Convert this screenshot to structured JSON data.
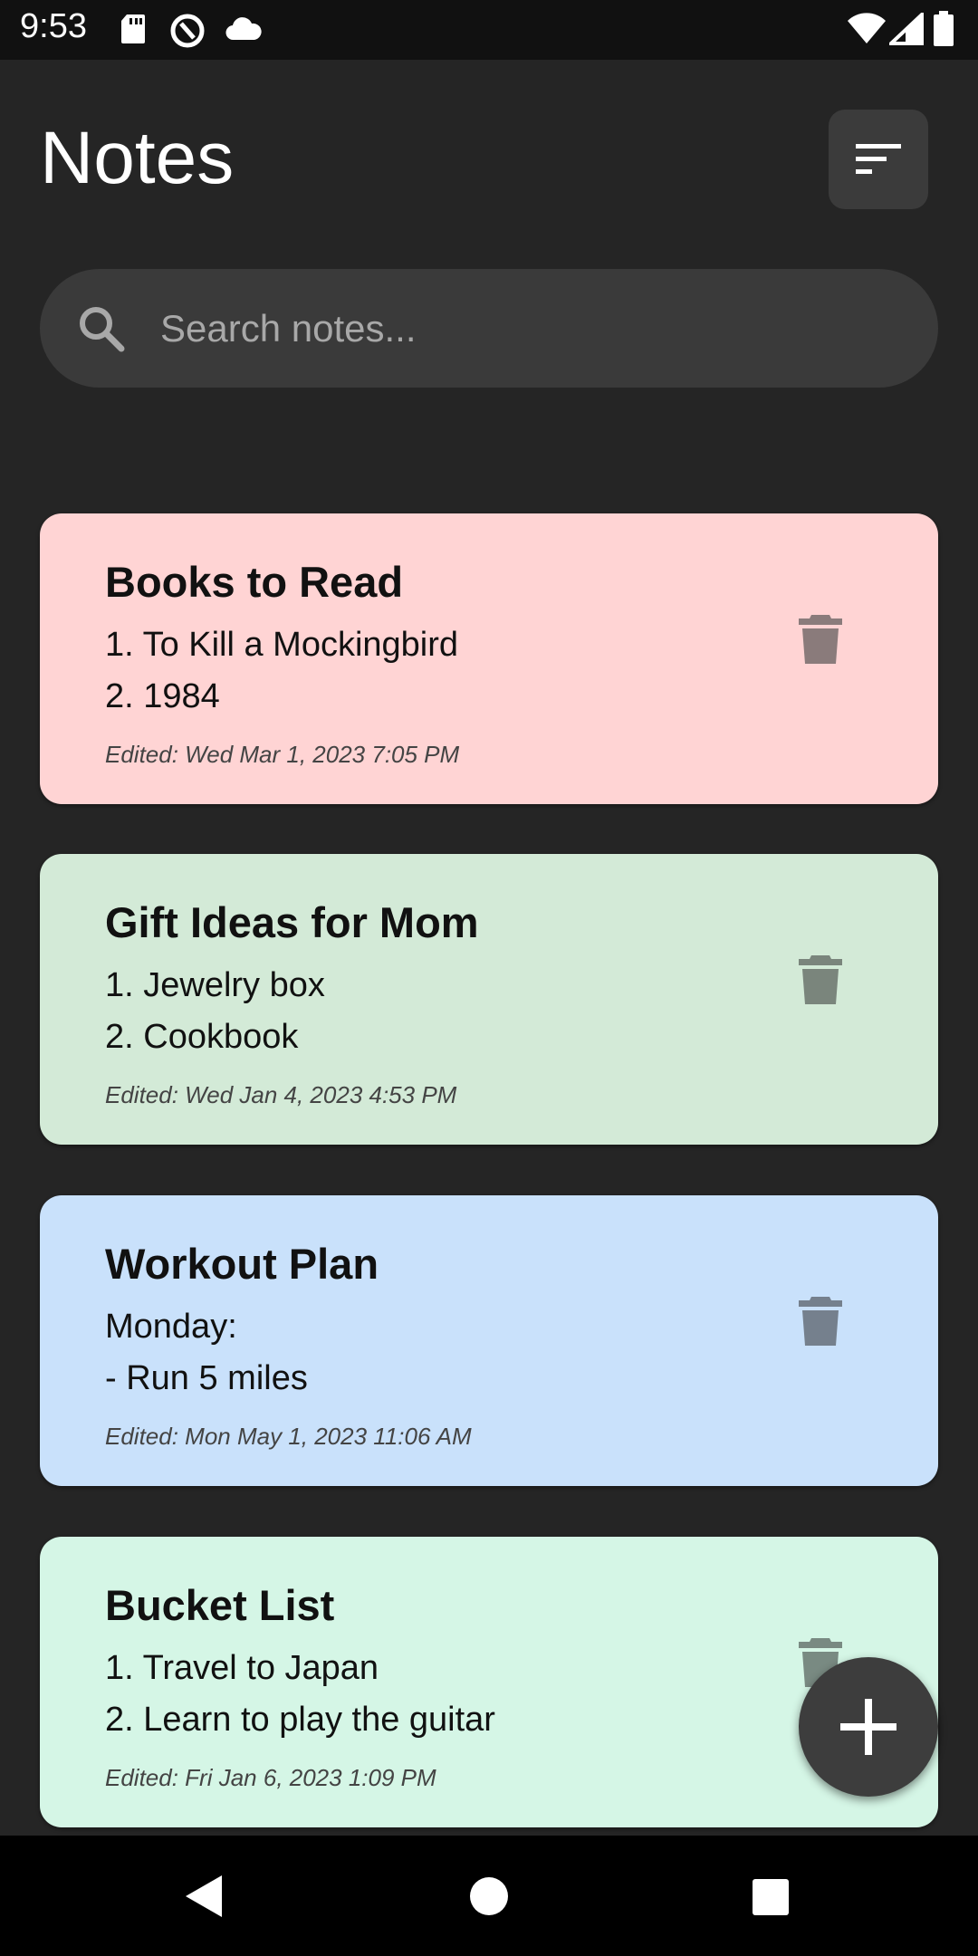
{
  "status_bar": {
    "time": "9:53",
    "icons": [
      "sd-card-icon",
      "data-saver-icon",
      "cloud-icon",
      "wifi-icon",
      "cell-signal-icon",
      "battery-icon"
    ]
  },
  "header": {
    "title": "Notes",
    "sort_icon": "sort-icon"
  },
  "search": {
    "placeholder": "Search notes...",
    "value": "",
    "icon": "search-icon"
  },
  "notes": [
    {
      "title": "Books to Read",
      "line1": "1. To Kill a Mockingbird",
      "line2": "2. 1984",
      "edited": "Edited: Wed Mar 1, 2023 7:05 PM",
      "color": "#ffd4d4",
      "trash_color": "#8a7b7b"
    },
    {
      "title": "Gift Ideas for Mom",
      "line1": "1. Jewelry box",
      "line2": "2. Cookbook",
      "edited": "Edited: Wed Jan 4, 2023 4:53 PM",
      "color": "#d3ead7",
      "trash_color": "#7a857c"
    },
    {
      "title": "Workout Plan",
      "line1": "Monday:",
      "line2": "- Run 5 miles",
      "edited": "Edited: Mon May 1, 2023 11:06 AM",
      "color": "#c9e1fb",
      "trash_color": "#75808d"
    },
    {
      "title": "Bucket List",
      "line1": "1. Travel to Japan",
      "line2": "2. Learn to play the guitar",
      "edited": "Edited: Fri Jan 6, 2023 1:09 PM",
      "color": "#d5f6e6",
      "trash_color": "#798a82"
    }
  ],
  "fab": {
    "icon": "plus-icon"
  },
  "nav_bar": {
    "buttons": [
      "back-icon",
      "home-icon",
      "recents-icon"
    ]
  },
  "colors": {
    "background": "#252525",
    "surface": "#3a3a3a",
    "status_bar": "#111111",
    "nav_bar": "#000000"
  }
}
